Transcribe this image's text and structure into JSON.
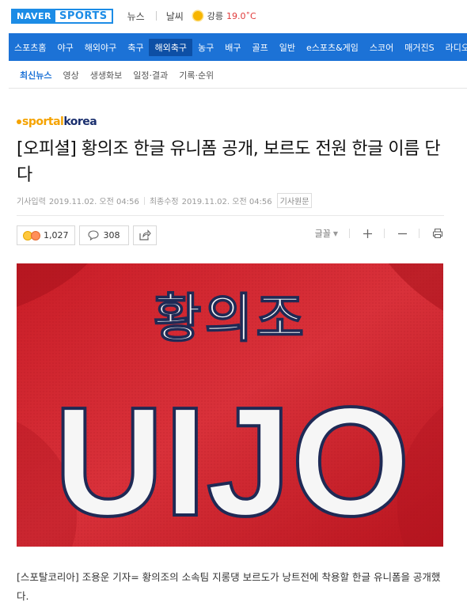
{
  "topbar": {
    "logo_naver": "NAVER",
    "logo_sports": "SPORTS",
    "news": "뉴스",
    "weather": "날씨",
    "weather_city": "강릉",
    "weather_temp": "19.0˚C"
  },
  "nav": {
    "items": [
      "스포츠홈",
      "야구",
      "해외야구",
      "축구",
      "해외축구",
      "농구",
      "배구",
      "골프",
      "일반",
      "e스포츠&게임",
      "스코어",
      "매거진S",
      "라디오"
    ],
    "active_index": 4
  },
  "subnav": {
    "items": [
      "최신뉴스",
      "영상",
      "생생화보",
      "일정·결과",
      "기록·순위"
    ]
  },
  "article": {
    "press_a": "sportal",
    "press_b": "korea",
    "title": "[오피셜] 황의조 한글 유니폼 공개, 보르도 전원 한글 이름 단다",
    "input_label": "기사입력",
    "input_date": "2019.11.02. 오전 04:56",
    "modified_label": "최종수정",
    "modified_date": "2019.11.02. 오전 04:56",
    "original_button": "기사원문",
    "reaction_count": "1,027",
    "comment_count": "308",
    "font_label": "글꼴",
    "photo_text_korean": "황의조",
    "photo_text_latin": "UIJO",
    "caption": "[스포탈코리아] 조용운 기자= 황의조의 소속팀 지롱댕 보르도가 낭트전에 착용할 한글 유니폼을 공개했다."
  },
  "colors": {
    "brand_blue": "#1c72d6",
    "jersey_red": "#d4272f",
    "press_orange": "#f5a300",
    "temp_red": "#e03a3a"
  }
}
